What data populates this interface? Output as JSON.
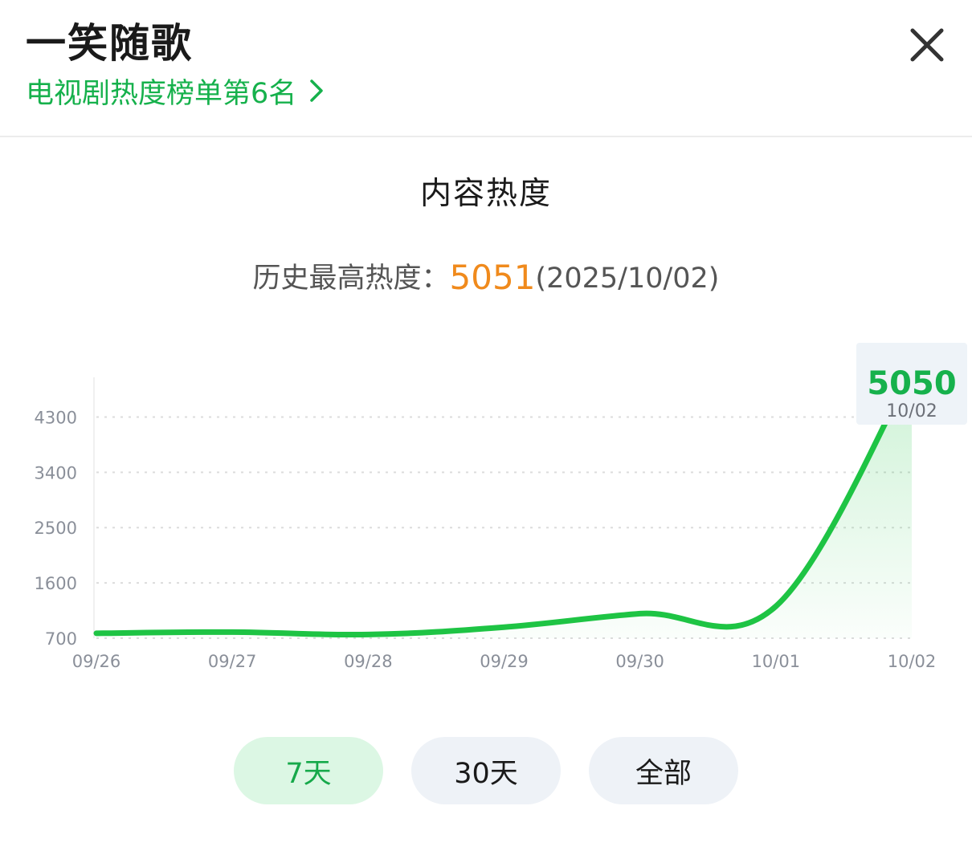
{
  "header": {
    "title": "一笑随歌",
    "rank_link": "电视剧热度榜单第6名"
  },
  "main": {
    "section_title": "内容热度",
    "peak_label": "历史最高热度：",
    "peak_value": "5051",
    "peak_date": "(2025/10/02)"
  },
  "tooltip": {
    "value": "5050",
    "date": "10/02"
  },
  "range_buttons": [
    {
      "label": "7天",
      "active": true
    },
    {
      "label": "30天",
      "active": false
    },
    {
      "label": "全部",
      "active": false
    }
  ],
  "colors": {
    "accent": "#16b14c",
    "line": "#1ec444",
    "peak": "#f08a1c",
    "axis_text": "#8a8f99"
  },
  "icons": {
    "close": "close-icon",
    "chevron": "chevron-right-icon"
  },
  "chart_data": {
    "type": "line",
    "categories": [
      "09/26",
      "09/27",
      "09/28",
      "09/29",
      "09/30",
      "10/01",
      "10/02"
    ],
    "series": [
      {
        "values": [
          780,
          800,
          760,
          880,
          1100,
          1220,
          5050
        ]
      }
    ],
    "y_ticks": [
      700,
      1600,
      2500,
      3400,
      4300
    ],
    "ylim": [
      700,
      5600
    ],
    "grid": true,
    "highlight": {
      "category": "10/02",
      "value": 5050
    }
  }
}
